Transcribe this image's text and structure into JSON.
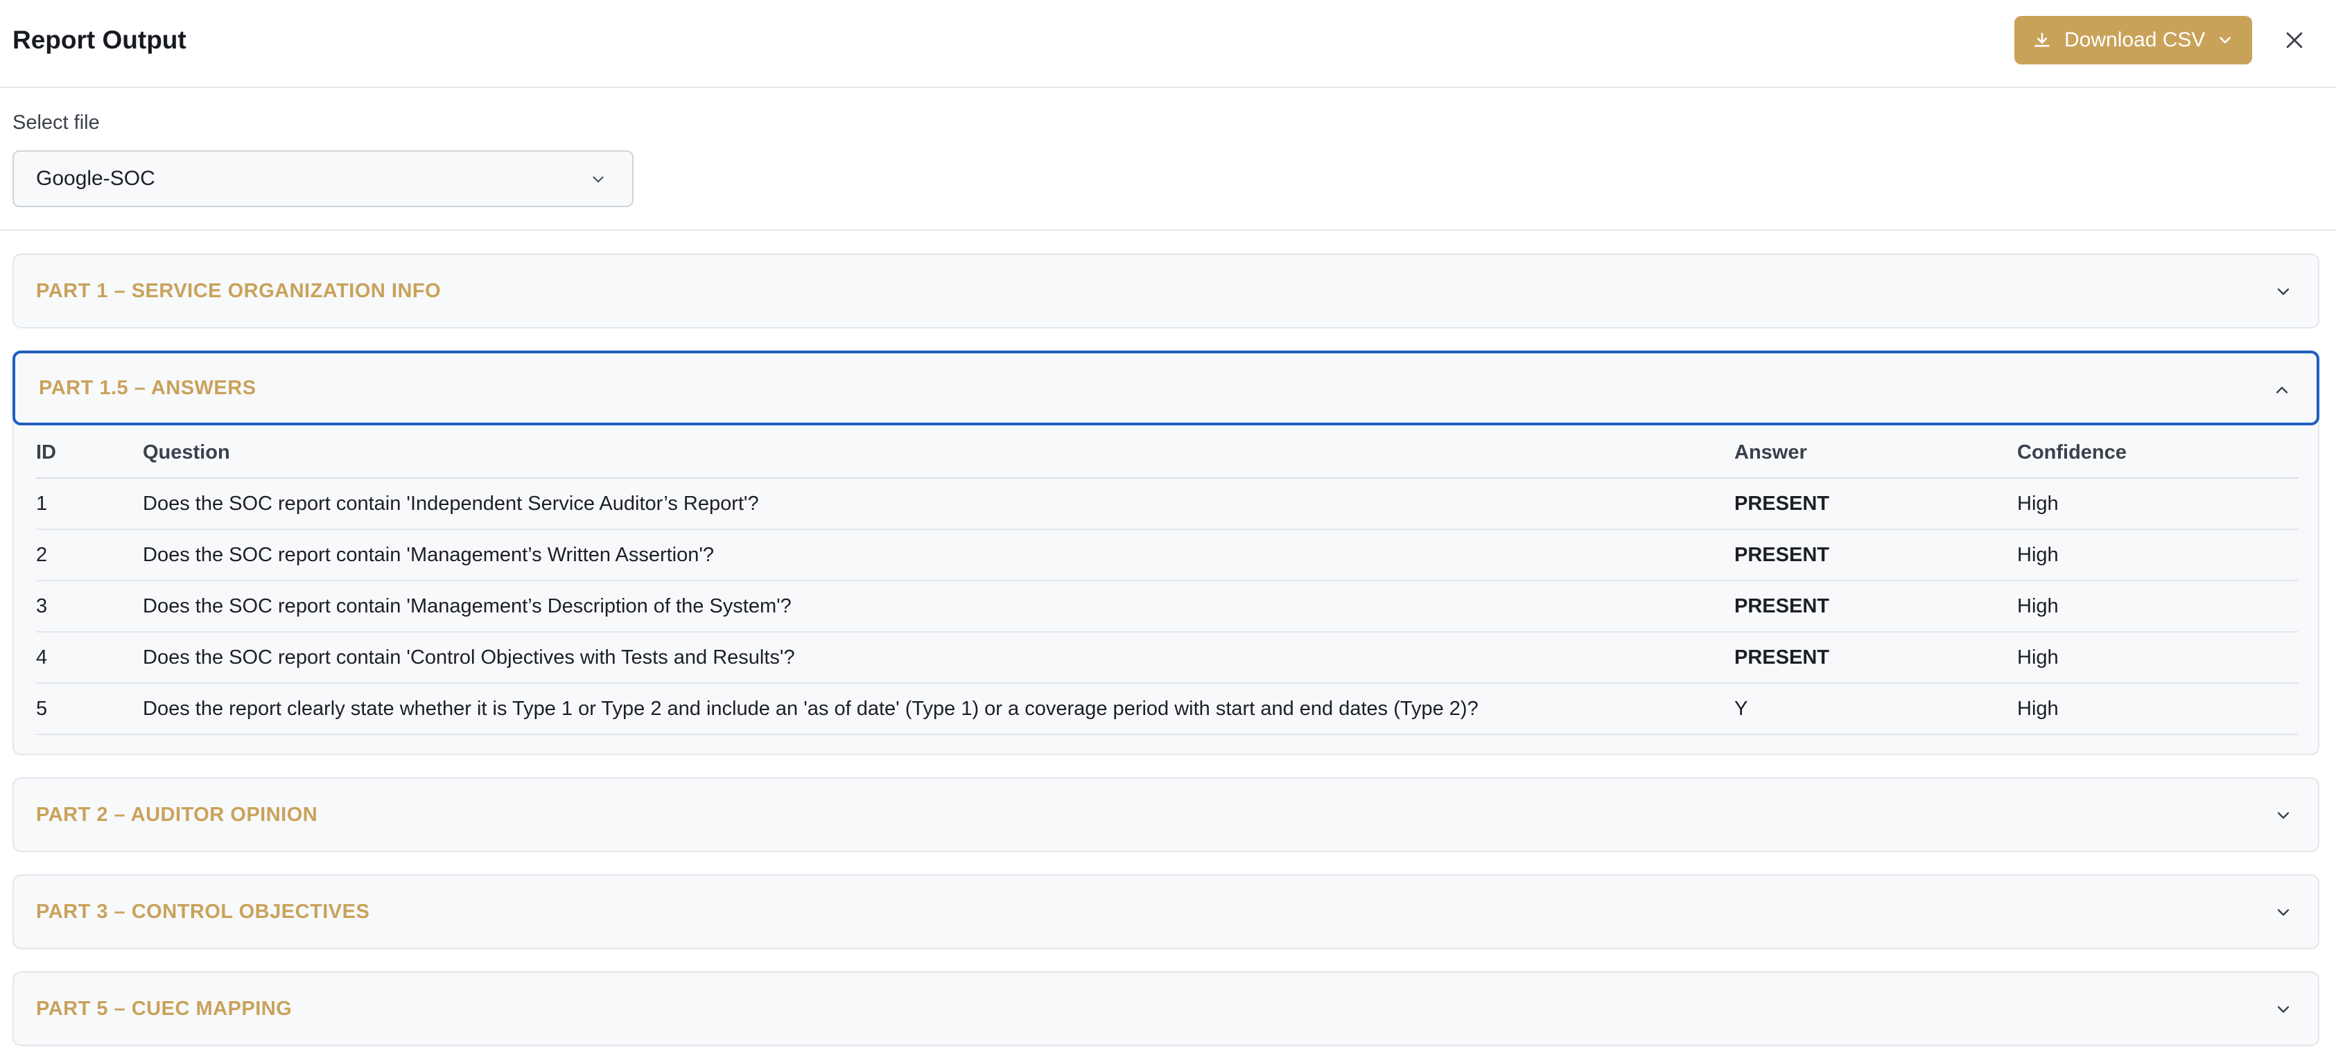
{
  "header": {
    "title": "Report Output",
    "download_label": "Download CSV"
  },
  "file_select": {
    "label": "Select file",
    "selected": "Google-SOC"
  },
  "sections": [
    {
      "title": "PART 1 – SERVICE ORGANIZATION INFO",
      "expanded": false
    },
    {
      "title": "PART 1.5 – ANSWERS",
      "expanded": true
    },
    {
      "title": "PART 2 – AUDITOR OPINION",
      "expanded": false
    },
    {
      "title": "PART 3 – CONTROL OBJECTIVES",
      "expanded": false
    },
    {
      "title": "PART 5 – CUEC MAPPING",
      "expanded": false
    }
  ],
  "answers_table": {
    "columns": [
      "ID",
      "Question",
      "Answer",
      "Confidence"
    ],
    "rows": [
      {
        "id": "1",
        "question": "Does the SOC report contain 'Independent Service Auditor’s Report'?",
        "answer": "PRESENT",
        "confidence": "High"
      },
      {
        "id": "2",
        "question": "Does the SOC report contain 'Management’s Written Assertion'?",
        "answer": "PRESENT",
        "confidence": "High"
      },
      {
        "id": "3",
        "question": "Does the SOC report contain 'Management’s Description of the System'?",
        "answer": "PRESENT",
        "confidence": "High"
      },
      {
        "id": "4",
        "question": "Does the SOC report contain 'Control Objectives with Tests and Results'?",
        "answer": "PRESENT",
        "confidence": "High"
      },
      {
        "id": "5",
        "question": "Does the report clearly state whether it is Type 1 or Type 2 and include an 'as of date' (Type 1) or a coverage period with start and end dates (Type 2)?",
        "answer": "Y",
        "confidence": "High"
      }
    ]
  },
  "colors": {
    "accent": "#c9a25a",
    "present": "#17a34a",
    "focus_border": "#1f5fbf"
  },
  "icons": {
    "download": "download-icon",
    "dropdown": "chevron-down-icon",
    "close": "close-icon",
    "collapse": "chevron-up-icon"
  }
}
